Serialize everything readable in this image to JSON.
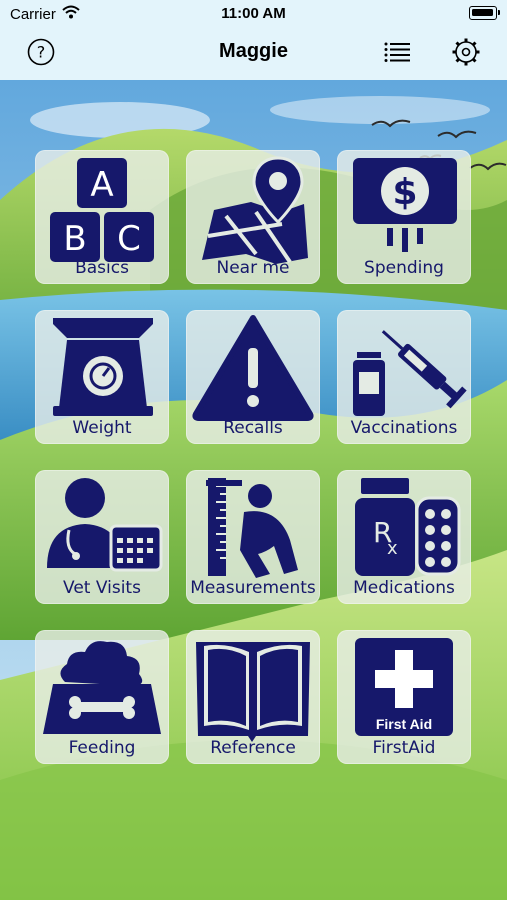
{
  "status_bar": {
    "carrier": "Carrier",
    "time": "11:00 AM"
  },
  "nav": {
    "title": "Maggie"
  },
  "icons": {
    "help": "question-circle-icon",
    "list": "list-icon",
    "settings": "gear-icon"
  },
  "colors": {
    "icon_navy": "#16186b",
    "nav_bg": "#e3f4fb"
  },
  "tiles": [
    {
      "label": "Basics",
      "icon": "abc-blocks-icon"
    },
    {
      "label": "Near me",
      "icon": "map-pin-icon"
    },
    {
      "label": "Spending",
      "icon": "dollar-sign-icon"
    },
    {
      "label": "Weight",
      "icon": "scale-icon"
    },
    {
      "label": "Recalls",
      "icon": "warning-icon"
    },
    {
      "label": "Vaccinations",
      "icon": "syringe-icon"
    },
    {
      "label": "Vet Visits",
      "icon": "vet-calendar-icon"
    },
    {
      "label": "Measurements",
      "icon": "measuring-icon"
    },
    {
      "label": "Medications",
      "icon": "rx-pills-icon"
    },
    {
      "label": "Feeding",
      "icon": "food-bowl-icon"
    },
    {
      "label": "Reference",
      "icon": "open-book-icon"
    },
    {
      "label": "FirstAid",
      "icon": "first-aid-icon",
      "badge": "First Aid"
    }
  ]
}
